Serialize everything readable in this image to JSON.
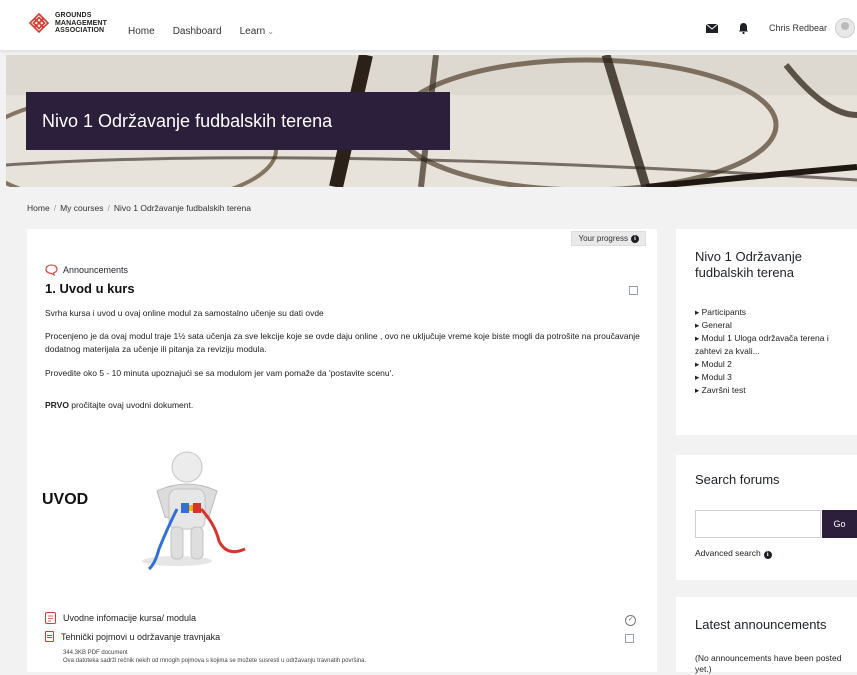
{
  "brand": {
    "logo_text": "GROUNDS\nMANAGEMENT\nASSOCIATION"
  },
  "nav": {
    "home": "Home",
    "dashboard": "Dashboard",
    "learn": "Learn"
  },
  "user": {
    "name": "Chris Redbear"
  },
  "banner": {
    "title": "Nivo 1 Održavanje fudbalskih terena"
  },
  "breadcrumb": {
    "items": [
      "Home",
      "My courses",
      "Nivo 1 Održavanje fudbalskih terena"
    ],
    "separator": "/"
  },
  "progress": {
    "label": "Your progress"
  },
  "section": {
    "announcements": "Announcements",
    "title": "1. Uvod u kurs",
    "paragraphs": [
      "Svrha kursa i uvod u ovaj online modul za samostalno učenje su dati ovde",
      "Procenjeno je da ovaj modul traje 1½ sata učenja za sve lekcije koje se ovde daju online , ovo ne uključuje vreme koje biste mogli da potrošite na proučavanje dodatnog materijala za učenje ili pitanja za reviziju  modula.",
      "Provedite oko 5 - 10 minuta upoznajući se sa modulom jer vam pomaže da 'postavite scenu'."
    ],
    "prvo_bold": "PRVO",
    "prvo_rest": " pročitajte ovaj uvodni dokument.",
    "image_label": "UVOD",
    "resources": [
      {
        "label": "Uvodne infomacije kursa/ modula"
      },
      {
        "label": "Tehnički pojmovi u održavanje travnjaka",
        "meta": "344.3KB PDF document",
        "desc": "Ova datoteka sadrži rečnik  nekih od mnogih pojmova s kojima se možete susresti u održavanju travnatih površina."
      }
    ]
  },
  "sidebar": {
    "course_title": "Nivo 1 Održavanje fudbalskih terena",
    "nav_items": [
      "Participants",
      "General",
      "Modul 1 Uloga održavača terena i zahtevi za kvali...",
      "Modul 2",
      "Modul 3",
      "Završni test"
    ],
    "search_title": "Search forums",
    "search_placeholder": "",
    "go": "Go",
    "advanced": "Advanced search",
    "latest_title": "Latest announcements",
    "latest_text": "(No announcements have been posted yet.)"
  },
  "colors": {
    "accent": "#2c1f3b",
    "icon_red": "#e0352d"
  }
}
